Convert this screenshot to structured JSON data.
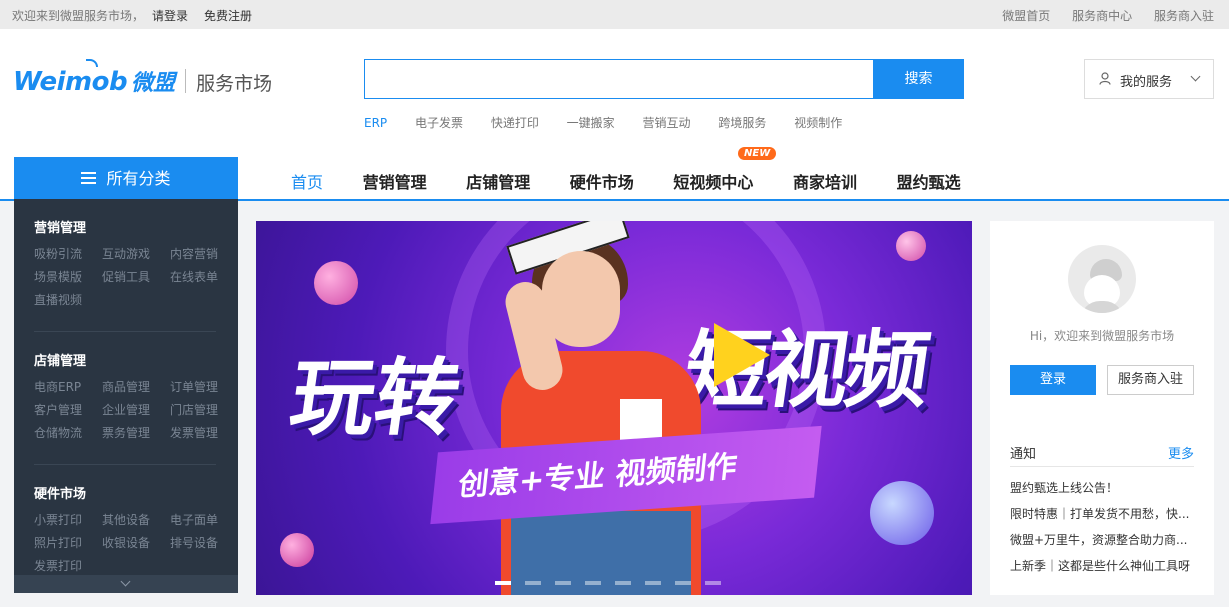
{
  "topbar": {
    "welcome": "欢迎来到微盟服务市场，",
    "login": "请登录",
    "register": "免费注册",
    "links": [
      "微盟首页",
      "服务商中心",
      "服务商入驻"
    ]
  },
  "logo": {
    "brand": "Weimob",
    "brand_cn": "微盟",
    "subtitle": "服务市场"
  },
  "search": {
    "placeholder": "",
    "button": "搜索"
  },
  "hotwords": [
    "ERP",
    "电子发票",
    "快递打印",
    "一键搬家",
    "营销互动",
    "跨境服务",
    "视频制作"
  ],
  "my_service": {
    "label": "我的服务"
  },
  "category_button": "所有分类",
  "nav": {
    "items": [
      "首页",
      "营销管理",
      "店铺管理",
      "硬件市场",
      "短视频中心",
      "商家培训",
      "盟约甄选"
    ],
    "badge": "NEW"
  },
  "sidebar": {
    "sections": [
      {
        "title": "营销管理",
        "items": [
          "吸粉引流",
          "互动游戏",
          "内容营销",
          "场景模版",
          "促销工具",
          "在线表单",
          "直播视频"
        ]
      },
      {
        "title": "店铺管理",
        "items": [
          "电商ERP",
          "商品管理",
          "订单管理",
          "客户管理",
          "企业管理",
          "门店管理",
          "仓储物流",
          "票务管理",
          "发票管理"
        ]
      },
      {
        "title": "硬件市场",
        "items": [
          "小票打印",
          "其他设备",
          "电子面单",
          "照片打印",
          "收银设备",
          "排号设备",
          "发票打印"
        ]
      }
    ]
  },
  "banner": {
    "word_left": "玩转",
    "word_right": "短视频",
    "strip_text": "创意+专业   视频制作",
    "slide_count": 8,
    "active_slide": 1
  },
  "panel": {
    "welcome": "Hi，欢迎来到微盟服务市场",
    "login_button": "登录",
    "join_button": "服务商入驻",
    "notice_title": "通知",
    "notice_more": "更多",
    "notices": [
      "盟约甄选上线公告！",
      "限时特惠｜打单发货不用愁，快...",
      "微盟+万里牛，资源整合助力商...",
      "上新季｜这都是些什么神仙工具呀"
    ]
  },
  "colors": {
    "accent": "#1a8cf0",
    "sidebar_bg": "#2a3542",
    "badge": "#ff6a1a"
  }
}
